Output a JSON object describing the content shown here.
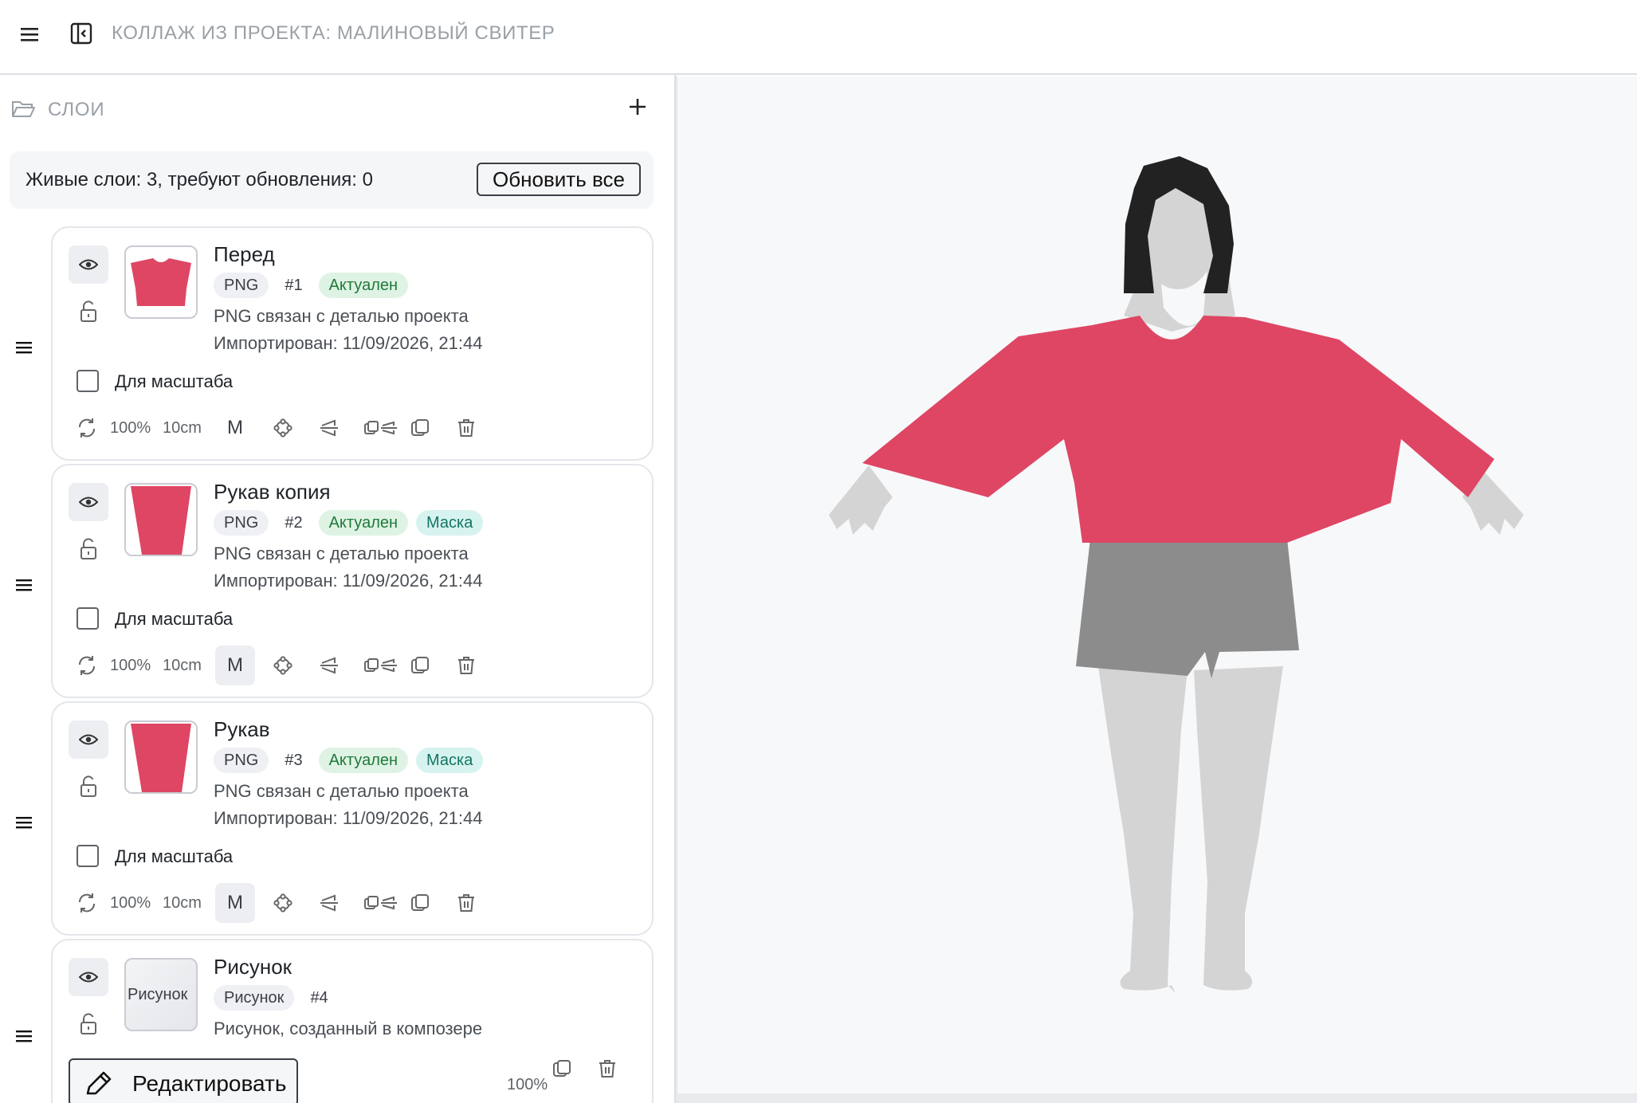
{
  "header": {
    "title": "КОЛЛАЖ ИЗ ПРОЕКТА: МАЛИНОВЫЙ СВИТЕР"
  },
  "layers_panel": {
    "label": "СЛОИ",
    "summary": "Живые слои: 3, требуют обновления: 0",
    "refresh_all_label": "Обновить все",
    "for_scale_label": "Для масштаба",
    "scale_percent": "100%",
    "scale_size": "10cm",
    "mask_toggle_label": "M",
    "layers": [
      {
        "name": "Перед",
        "badges": [
          "PNG",
          "#1",
          "Актуален"
        ],
        "description": "PNG связан с деталью проекта",
        "imported": "Импортирован: 11/09/2026, 21:44",
        "mask_active": false
      },
      {
        "name": "Рукав копия",
        "badges": [
          "PNG",
          "#2",
          "Актуален",
          "Маска"
        ],
        "description": "PNG связан с деталью проекта",
        "imported": "Импортирован: 11/09/2026, 21:44",
        "mask_active": true
      },
      {
        "name": "Рукав",
        "badges": [
          "PNG",
          "#3",
          "Актуален",
          "Маска"
        ],
        "description": "PNG связан с деталью проекта",
        "imported": "Импортирован: 11/09/2026, 21:44",
        "mask_active": true
      },
      {
        "name": "Рисунок",
        "thumb_text": "Рисунок",
        "badges": [
          "Рисунок",
          "#4"
        ],
        "description": "Рисунок, созданный в композере",
        "edit_label": "Редактировать",
        "scale_percent": "100%"
      }
    ]
  },
  "colors": {
    "sweater": "#de4664",
    "shorts": "#8c8c8c",
    "body": "#d4d4d4",
    "hair": "#222222",
    "canvas_bg": "#f7f8fa",
    "badge_green_bg": "#dff3e4",
    "badge_teal_bg": "#d7f3ef"
  },
  "icons": [
    "menu-icon",
    "sidebar-collapse-icon",
    "folder-icon",
    "plus-icon",
    "drag-handle-icon",
    "eye-icon",
    "unlock-icon",
    "rotate-icon",
    "transform-icon",
    "flip-icon",
    "duplicate-flip-icon",
    "copy-icon",
    "trash-icon",
    "pencil-icon"
  ]
}
